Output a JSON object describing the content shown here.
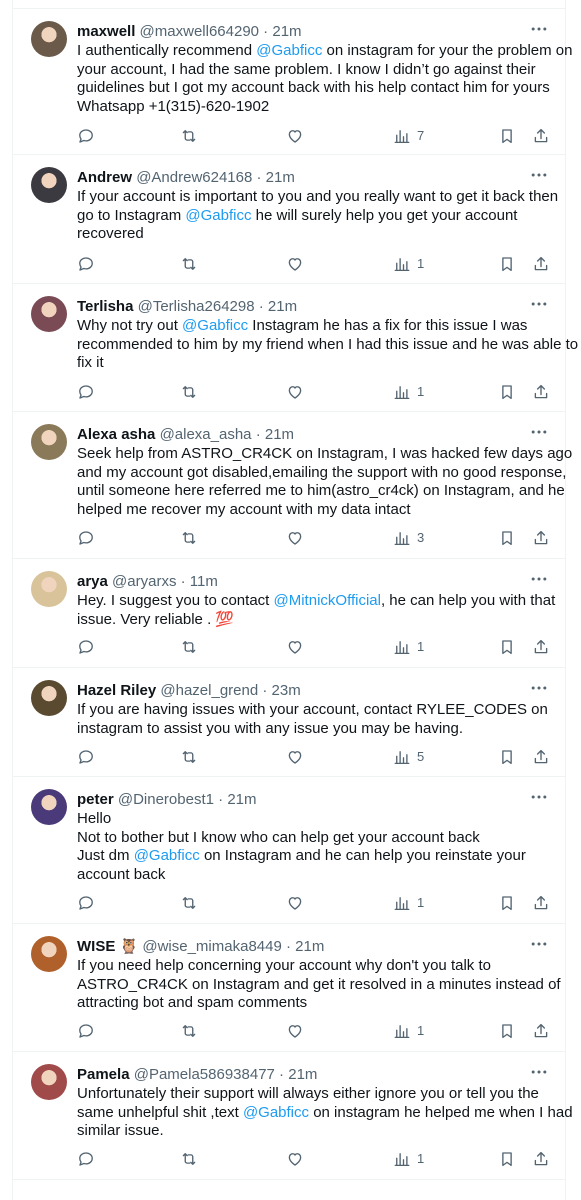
{
  "tweets": [
    {
      "name": "maxwell",
      "handle": "@maxwell664290",
      "sep": " · ",
      "time": "21m",
      "avatar_color": "#6b5a4a",
      "lines": [
        [
          {
            "t": "I authentically recommend "
          },
          {
            "t": "@Gabficc",
            "m": true
          },
          {
            "t": " on instagram for your the problem on"
          }
        ],
        [
          {
            "t": "your account, I had the same problem.  I know I didn’t go against their"
          }
        ],
        [
          {
            "t": "guidelines but I   got my account back with his help contact him for yours"
          }
        ],
        [
          {
            "t": "Whatsapp +1(315)-620-1902"
          }
        ]
      ],
      "views": "7"
    },
    {
      "name": "Andrew",
      "handle": "@Andrew624168",
      "sep": " · ",
      "time": "21m",
      "avatar_color": "#3a3a40",
      "lines": [
        [
          {
            "t": "If your account is important to you and you really want to get it back then"
          }
        ],
        [
          {
            "t": "go to Instagram "
          },
          {
            "t": "@Gabficc",
            "m": true
          },
          {
            "t": " he will surely help you get your account"
          }
        ],
        [
          {
            "t": "recovered"
          }
        ]
      ],
      "views": "1"
    },
    {
      "name": "Terlisha",
      "handle": "@Terlisha264298",
      "sep": " · ",
      "time": "21m",
      "avatar_color": "#7a4a55",
      "lines": [
        [
          {
            "t": "Why not try out "
          },
          {
            "t": "@Gabficc",
            "m": true
          },
          {
            "t": " Instagram he has a fix for this issue I was"
          }
        ],
        [
          {
            "t": "recommended to him by my friend when I had this issue and he was able to"
          }
        ],
        [
          {
            "t": "fix it"
          }
        ]
      ],
      "views": "1"
    },
    {
      "name": "Alexa asha",
      "handle": "@alexa_asha",
      "sep": " · ",
      "time": "21m",
      "avatar_color": "#8a7a5a",
      "lines": [
        [
          {
            "t": "Seek help from ASTRO_CR4CK on Instagram, I was hacked few days ago"
          }
        ],
        [
          {
            "t": "and my account got disabled,emailing the support with no good response,"
          }
        ],
        [
          {
            "t": "until someone here referred me to him(astro_cr4ck) on Instagram, and he"
          }
        ],
        [
          {
            "t": "helped me recover my account with my data intact"
          }
        ]
      ],
      "views": "3"
    },
    {
      "name": "arya",
      "handle": "@aryarxs",
      "sep": " · ",
      "time": "11m",
      "avatar_color": "#d8c39a",
      "lines": [
        [
          {
            "t": "Hey. I suggest you to contact "
          },
          {
            "t": "@MitnickOfficial",
            "m": true
          },
          {
            "t": ", he can help you with that"
          }
        ],
        [
          {
            "t": "issue. Very reliable . "
          },
          {
            "t": "💯",
            "e": true
          }
        ]
      ],
      "views": "1"
    },
    {
      "name": "Hazel Riley",
      "handle": "@hazel_grend",
      "sep": " · ",
      "time": "23m",
      "avatar_color": "#5a4a30",
      "lines": [
        [
          {
            "t": "If you are having issues with your account, contact RYLEE_CODES on"
          }
        ],
        [
          {
            "t": "instagram to assist you with any issue you may be having."
          }
        ]
      ],
      "views": "5"
    },
    {
      "name": "peter",
      "handle": "@Dinerobest1",
      "sep": " · ",
      "time": "21m",
      "avatar_color": "#4a3a7a",
      "lines": [
        [
          {
            "t": "Hello"
          }
        ],
        [
          {
            "t": "Not to bother but I know who can help get your account back"
          }
        ],
        [
          {
            "t": "Just dm "
          },
          {
            "t": "@Gabficc",
            "m": true
          },
          {
            "t": " on Instagram and he can help you reinstate your"
          }
        ],
        [
          {
            "t": "account back"
          }
        ]
      ],
      "views": "1"
    },
    {
      "name": "WISE 🦉",
      "handle": "@wise_mimaka8449",
      "sep": " · ",
      "time": "21m",
      "avatar_color": "#b0602a",
      "lines": [
        [
          {
            "t": "If you need help concerning your account why don't you talk to"
          }
        ],
        [
          {
            "t": "ASTRO_CR4CK on Instagram and get it resolved in a minutes instead of"
          }
        ],
        [
          {
            "t": "attracting bot and spam comments"
          }
        ]
      ],
      "views": "1"
    },
    {
      "name": "Pamela",
      "handle": "@Pamela586938477",
      "sep": " · ",
      "time": "21m",
      "avatar_color": "#a04a4a",
      "lines": [
        [
          {
            "t": "Unfortunately their support will always either ignore you or tell you the"
          }
        ],
        [
          {
            "t": "same unhelpful shit ,text "
          },
          {
            "t": "@Gabficc",
            "m": true
          },
          {
            "t": " on instagram he helped me when I had"
          }
        ],
        [
          {
            "t": "similar issue."
          }
        ]
      ],
      "views": "1"
    }
  ],
  "icons": {
    "more": "more-icon",
    "reply": "reply-icon",
    "retweet": "retweet-icon",
    "like": "like-icon",
    "views": "views-icon",
    "bookmark": "bookmark-icon",
    "share": "share-icon"
  },
  "colors": {
    "text": "#0f1419",
    "muted": "#536471",
    "link": "#1d9bf0",
    "divider": "#eff3f4"
  }
}
